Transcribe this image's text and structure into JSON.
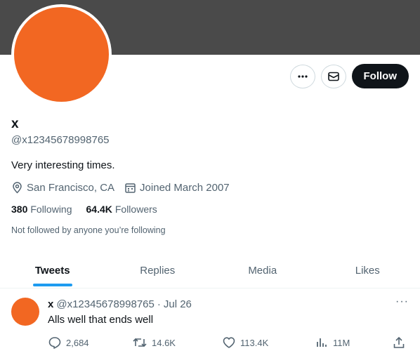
{
  "profile": {
    "name": "x",
    "handle": "@x12345678998765",
    "bio": "Very interesting times.",
    "location": "San Francisco, CA",
    "joined": "Joined March 2007",
    "following_count": "380",
    "following_label": "Following",
    "followers_count": "64.4K",
    "followers_label": "Followers",
    "not_followed_text": "Not followed by anyone you’re following",
    "avatar_color": "#f26722",
    "banner_color": "#4a4a4a"
  },
  "actions": {
    "more_icon": "more-icon",
    "message_icon": "message-icon",
    "follow_label": "Follow"
  },
  "tabs": [
    {
      "label": "Tweets",
      "active": true
    },
    {
      "label": "Replies",
      "active": false
    },
    {
      "label": "Media",
      "active": false
    },
    {
      "label": "Likes",
      "active": false
    }
  ],
  "tweet": {
    "author": "x",
    "handle": "@x12345678998765",
    "separator": "·",
    "date": "Jul 26",
    "text": "Alls well that ends well",
    "more": "···",
    "replies": "2,684",
    "retweets": "14.6K",
    "likes": "113.4K",
    "views": "11M"
  },
  "colors": {
    "accent": "#1d9bf0",
    "follow_bg": "#0f1419"
  }
}
